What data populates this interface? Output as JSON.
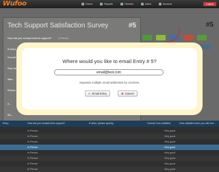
{
  "app": {
    "logo": "Wufoo"
  },
  "nav": {
    "items": [
      "Forms",
      "Reports",
      "Themes",
      "Users",
      "Account"
    ],
    "logout": "Logout"
  },
  "entry": {
    "title": "Tech Support Satisfaction Survey",
    "number": "#5",
    "fields": [
      {
        "q": "How did you contact to/tech support?",
        "a": "In Person"
      },
      {
        "q": "If other, please specify",
        "a": ""
      },
      {
        "q": "Overall...",
        "a": ""
      },
      {
        "q": "How satisfied...",
        "a": ""
      },
      {
        "q": "Was...",
        "a": ""
      },
      {
        "q": "Please...",
        "a": ""
      },
      {
        "q": "If ...",
        "a": ""
      },
      {
        "q": "Bu...",
        "a": ""
      }
    ]
  },
  "side": {
    "entry_tag": "#5",
    "label": "Email Entry #5"
  },
  "grid": {
    "header": [
      "Entry",
      "How did you contact tech support?",
      "If other, please specify",
      "Overall, how satisfied",
      "How satisfied were you with the..."
    ],
    "rows": [
      {
        "cells": [
          "",
          "In Person",
          "",
          "Very good",
          ""
        ]
      },
      {
        "cells": [
          "",
          "In Person",
          "",
          "Very good",
          ""
        ]
      },
      {
        "cells": [
          "",
          "In Person",
          "",
          "Very good",
          ""
        ]
      },
      {
        "cells": [
          "",
          "In Person",
          "",
          "Very good",
          ""
        ]
      },
      {
        "cells": [
          "",
          "In Person",
          "",
          "Very good",
          ""
        ]
      },
      {
        "cells": [
          "",
          "In Person",
          "",
          "Very good",
          ""
        ]
      },
      {
        "cells": [
          "",
          "In Person",
          "",
          "Very good",
          ""
        ]
      },
      {
        "cells": [
          "",
          "In Person",
          "",
          "Very good",
          ""
        ]
      }
    ]
  },
  "modal": {
    "title": "Where would you like to email Entry # 5?",
    "email_value": "email@test.com",
    "hint": "Separate multiple email addresses by commas.",
    "email_button": "Email Entry",
    "cancel_button": "Cancel"
  },
  "colors": {
    "accent": "#f07d20",
    "modal_border": "#fff5c8",
    "selected_row": "#3b6d92"
  }
}
